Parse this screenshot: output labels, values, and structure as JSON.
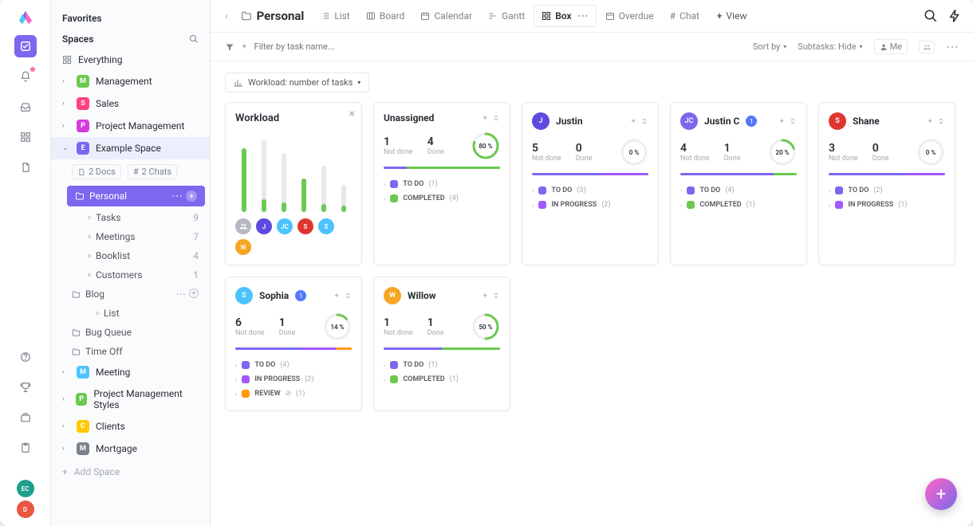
{
  "rail": {
    "avatars": [
      {
        "initials": "EC",
        "bg": "#1f9e8c"
      },
      {
        "initials": "D",
        "bg": "#e85642"
      }
    ]
  },
  "sidebar": {
    "favorites_label": "Favorites",
    "spaces_label": "Spaces",
    "everything_label": "Everything",
    "spaces": [
      {
        "letter": "M",
        "label": "Management",
        "bg": "#6bc950"
      },
      {
        "letter": "S",
        "label": "Sales",
        "bg": "#ff4081"
      },
      {
        "letter": "P",
        "label": "Project Management",
        "bg": "#d63cdb"
      },
      {
        "letter": "E",
        "label": "Example Space",
        "bg": "#7b68ee",
        "expanded": true
      }
    ],
    "docs_chip": "2 Docs",
    "chats_chip": "2 Chats",
    "active_list": "Personal",
    "lists": [
      {
        "label": "Tasks",
        "count": 9
      },
      {
        "label": "Meetings",
        "count": 7
      },
      {
        "label": "Booklist",
        "count": 4
      },
      {
        "label": "Customers",
        "count": 1
      }
    ],
    "folders": [
      {
        "label": "Blog",
        "actions": true,
        "sub": [
          {
            "label": "List"
          }
        ]
      },
      {
        "label": "Bug Queue"
      },
      {
        "label": "Time Off"
      }
    ],
    "spaces2": [
      {
        "letter": "M",
        "label": "Meeting",
        "bg": "#4cc3ff"
      },
      {
        "letter": "P",
        "label": "Project Management Styles",
        "bg": "#6bc950"
      },
      {
        "letter": "C",
        "label": "Clients",
        "bg": "#ffc800"
      },
      {
        "letter": "M",
        "label": "Mortgage",
        "bg": "#7c828d"
      }
    ],
    "add_space": "Add Space"
  },
  "viewbar": {
    "title": "Personal",
    "views": [
      {
        "label": "List"
      },
      {
        "label": "Board"
      },
      {
        "label": "Calendar"
      },
      {
        "label": "Gantt"
      },
      {
        "label": "Box",
        "active": true
      },
      {
        "label": "Overdue"
      },
      {
        "label": "Chat"
      }
    ],
    "add_view": "View"
  },
  "filterbar": {
    "filter_placeholder": "Filter by task name...",
    "sortby": "Sort by",
    "subtasks": "Subtasks: Hide",
    "me": "Me"
  },
  "workload_toggle": "Workload: number of tasks",
  "workload_card": {
    "title": "Workload",
    "bars": [
      {
        "h": 80,
        "f": 80,
        "avatar": {
          "initials": "",
          "bg": "#b5b9c2",
          "group": true
        }
      },
      {
        "h": 90,
        "f": 16,
        "avatar": {
          "initials": "J",
          "bg": "#5d4ae0"
        }
      },
      {
        "h": 74,
        "f": 12,
        "avatar": {
          "initials": "JC",
          "bg": "#4cc3ff"
        }
      },
      {
        "h": 42,
        "f": 42,
        "avatar": {
          "initials": "S",
          "bg": "#de3730"
        }
      },
      {
        "h": 58,
        "f": 10,
        "avatar": {
          "initials": "S",
          "bg": "#4cc3ff"
        }
      },
      {
        "h": 34,
        "f": 8,
        "avatar": {
          "initials": "W",
          "bg": "#f5a623"
        }
      }
    ]
  },
  "cards": [
    {
      "title": "Unassigned",
      "avatar": null,
      "not_done": 1,
      "done": 4,
      "pct": 80,
      "bar": [
        {
          "c": "#7b68ee",
          "w": 20
        },
        {
          "c": "#6bc950",
          "w": 80
        }
      ],
      "statuses": [
        {
          "c": "#7b68ee",
          "label": "TO DO",
          "n": 1
        },
        {
          "c": "#6bc950",
          "label": "COMPLETED",
          "n": 4
        }
      ]
    },
    {
      "title": "Justin",
      "avatar": {
        "initials": "J",
        "bg": "#5d4ae0"
      },
      "not_done": 5,
      "done": 0,
      "pct": 0,
      "bar": [
        {
          "c": "#7b68ee",
          "w": 60
        },
        {
          "c": "#a259ff",
          "w": 40
        }
      ],
      "statuses": [
        {
          "c": "#7b68ee",
          "label": "TO DO",
          "n": 3
        },
        {
          "c": "#a259ff",
          "label": "IN PROGRESS",
          "n": 2
        }
      ]
    },
    {
      "title": "Justin C",
      "avatar": {
        "initials": "JC",
        "bg": "#7b68ee"
      },
      "badge": 1,
      "not_done": 4,
      "done": 1,
      "pct": 20,
      "bar": [
        {
          "c": "#7b68ee",
          "w": 80
        },
        {
          "c": "#6bc950",
          "w": 20
        }
      ],
      "statuses": [
        {
          "c": "#7b68ee",
          "label": "TO DO",
          "n": 4
        },
        {
          "c": "#6bc950",
          "label": "COMPLETED",
          "n": 1
        }
      ]
    },
    {
      "title": "Shane",
      "avatar": {
        "initials": "S",
        "bg": "#de3730"
      },
      "not_done": 3,
      "done": 0,
      "pct": 0,
      "bar": [
        {
          "c": "#7b68ee",
          "w": 66
        },
        {
          "c": "#a259ff",
          "w": 34
        }
      ],
      "statuses": [
        {
          "c": "#7b68ee",
          "label": "TO DO",
          "n": 2
        },
        {
          "c": "#a259ff",
          "label": "IN PROGRESS",
          "n": 1
        }
      ]
    },
    {
      "title": "Sophia",
      "avatar": {
        "initials": "S",
        "bg": "#4cc3ff"
      },
      "badge": 1,
      "not_done": 6,
      "done": 1,
      "pct": 14,
      "bar": [
        {
          "c": "#7b68ee",
          "w": 57
        },
        {
          "c": "#a259ff",
          "w": 29
        },
        {
          "c": "#ff9800",
          "w": 14
        }
      ],
      "statuses": [
        {
          "c": "#7b68ee",
          "label": "TO DO",
          "n": 4
        },
        {
          "c": "#a259ff",
          "label": "IN PROGRESS",
          "n": 2
        },
        {
          "c": "#ff9800",
          "label": "REVIEW",
          "n": 1,
          "check": true
        }
      ]
    },
    {
      "title": "Willow",
      "avatar": {
        "initials": "W",
        "bg": "#f5a623"
      },
      "not_done": 1,
      "done": 1,
      "pct": 50,
      "bar": [
        {
          "c": "#7b68ee",
          "w": 50
        },
        {
          "c": "#6bc950",
          "w": 50
        }
      ],
      "statuses": [
        {
          "c": "#7b68ee",
          "label": "TO DO",
          "n": 1
        },
        {
          "c": "#6bc950",
          "label": "COMPLETED",
          "n": 1
        }
      ]
    }
  ],
  "labels": {
    "not_done": "Not done",
    "done": "Done"
  }
}
